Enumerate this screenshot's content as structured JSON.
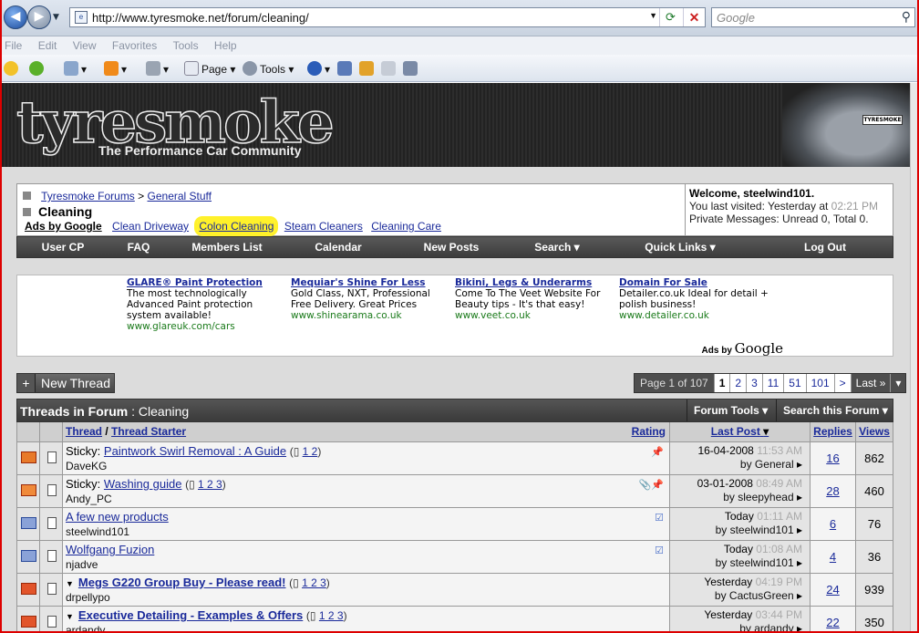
{
  "browser": {
    "url": "http://www.tyresmoke.net/forum/cleaning/",
    "search_placeholder": "Google",
    "menu": [
      "File",
      "Edit",
      "View",
      "Favorites",
      "Tools",
      "Help"
    ],
    "page_label": "Page",
    "tools_label": "Tools"
  },
  "site": {
    "logo": "tyresmoke",
    "tagline": "The Performance Car Community",
    "plate": "TYRESMOKE"
  },
  "breadcrumb": {
    "forums": "Tyresmoke Forums",
    "separator": ">",
    "section": "General Stuff",
    "current": "Cleaning"
  },
  "ads_links": {
    "label": "Ads by Google",
    "links": [
      "Clean Driveway",
      "Colon Cleaning",
      "Steam Cleaners",
      "Cleaning Care"
    ]
  },
  "welcome": {
    "line1": "Welcome, steelwind101.",
    "line2": "You last visited: Yesterday at",
    "time": "02:21 PM",
    "line3": "Private Messages: Unread 0, Total 0."
  },
  "nav": [
    "User CP",
    "FAQ",
    "Members List",
    "Calendar",
    "New Posts",
    "Search ▾",
    "Quick Links ▾",
    "Log Out"
  ],
  "ads": [
    {
      "h": "GLARE® Paint Protection",
      "t": "The most technologically Advanced Paint protection system available!",
      "u": "www.glareuk.com/cars"
    },
    {
      "h": "Mequiar's Shine For Less",
      "t": "Gold Class, NXT, Professional Free Delivery. Great Prices",
      "u": "www.shinearama.co.uk"
    },
    {
      "h": "Bikini, Legs & Underarms",
      "t": "Come To The Veet Website For Beauty tips - It's that easy!",
      "u": "www.veet.co.uk"
    },
    {
      "h": "Domain For Sale",
      "t": "Detailer.co.uk Ideal for detail + polish business!",
      "u": "www.detailer.co.uk"
    }
  ],
  "ads_by": "Ads by",
  "ads_by_brand": "Google",
  "new_thread": "New Thread",
  "pager": {
    "label": "Page 1 of 107",
    "pages": [
      "1",
      "2",
      "3",
      "11",
      "51",
      "101",
      ">"
    ],
    "last": "Last »",
    "more": "▾"
  },
  "forum_header": {
    "title": "Threads in Forum",
    "sep": ":",
    "name": "Cleaning",
    "tools": "Forum Tools ▾",
    "search": "Search this Forum ▾"
  },
  "columns": {
    "thread": "Thread",
    "slash": "/",
    "starter": "Thread Starter",
    "rating": "Rating",
    "last_post": "Last Post",
    "replies": "Replies",
    "views": "Views"
  },
  "threads": [
    {
      "prefix": "Sticky:",
      "title": "Paintwork Swirl Removal : A Guide",
      "pages": "1 2",
      "starter": "DaveKG",
      "date": "16-04-2008",
      "time": "11:53 AM",
      "by": "by General",
      "replies": "16",
      "views": "862",
      "flag": "📌"
    },
    {
      "prefix": "Sticky:",
      "title": "Washing guide",
      "pages": "1 2 3",
      "starter": "Andy_PC",
      "date": "03-01-2008",
      "time": "08:49 AM",
      "by": "by sleepyhead",
      "replies": "28",
      "views": "460",
      "flag": "📎📌"
    },
    {
      "prefix": "",
      "title": "A few new products",
      "pages": "",
      "starter": "steelwind101",
      "date": "Today",
      "time": "01:11 AM",
      "by": "by steelwind101",
      "replies": "6",
      "views": "76",
      "flag": "☑"
    },
    {
      "prefix": "",
      "title": "Wolfgang Fuzion",
      "pages": "",
      "starter": "njadve",
      "date": "Today",
      "time": "01:08 AM",
      "by": "by steelwind101",
      "replies": "4",
      "views": "36",
      "flag": "☑"
    },
    {
      "prefix": "",
      "title": "Megs G220 Group Buy - Please read!",
      "pages": "1 2 3",
      "starter": "drpellypo",
      "date": "Yesterday",
      "time": "04:19 PM",
      "by": "by CactusGreen",
      "replies": "24",
      "views": "939",
      "flag": ""
    },
    {
      "prefix": "",
      "title": "Executive Detailing - Examples & Offers",
      "pages": "1 2 3",
      "starter": "ardandy",
      "date": "Yesterday",
      "time": "03:44 PM",
      "by": "by ardandy",
      "replies": "22",
      "views": "350",
      "flag": ""
    }
  ],
  "colors": {
    "accent": "#1a2a9a",
    "highlight": "#fff12a",
    "header": "#3a3a3a"
  }
}
